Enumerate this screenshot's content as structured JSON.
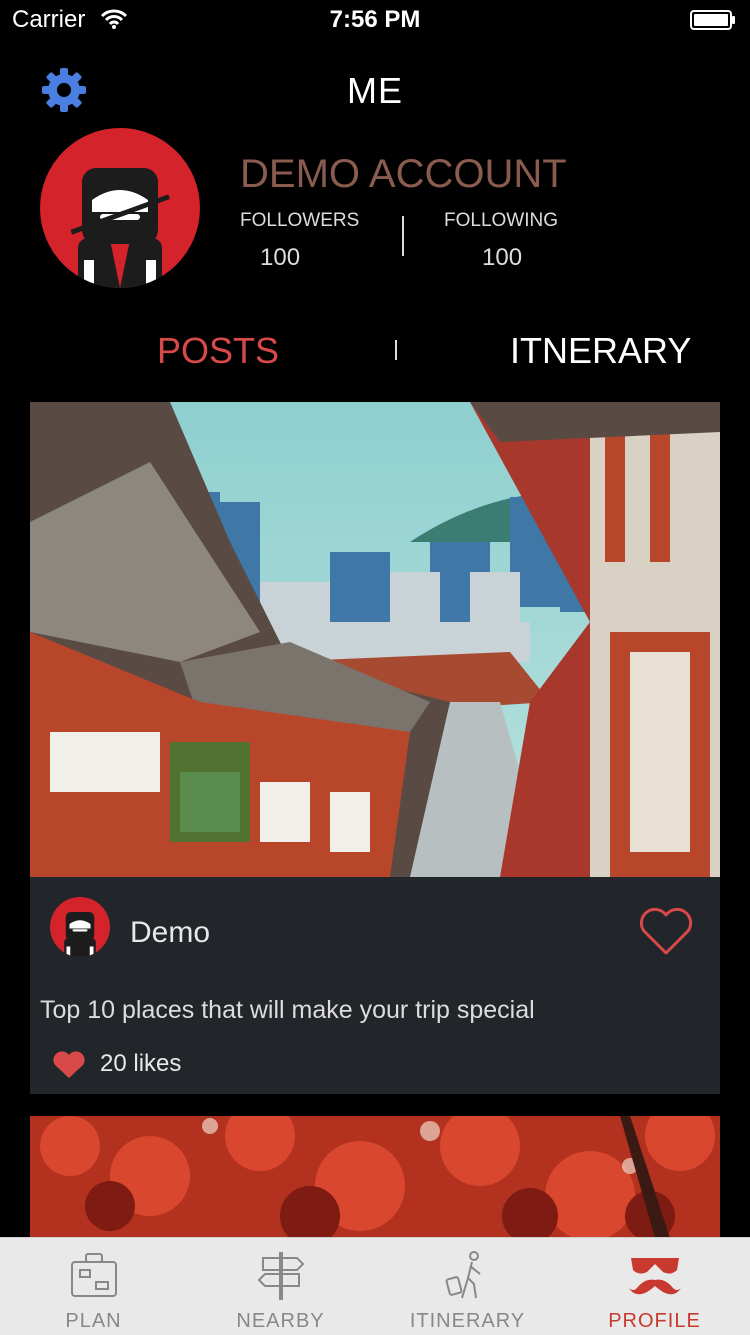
{
  "status_bar": {
    "carrier": "Carrier",
    "time": "7:56 PM"
  },
  "header": {
    "title": "ME"
  },
  "profile": {
    "name": "DEMO ACCOUNT",
    "followers_label": "FOLLOWERS",
    "followers_count": "100",
    "following_label": "FOLLOWING",
    "following_count": "100"
  },
  "tabs": {
    "posts": "POSTS",
    "itinerary": "ITNERARY",
    "active": "posts"
  },
  "posts": [
    {
      "author": "Demo",
      "caption": "Top 10 places that will make your trip special",
      "likes": "20 likes",
      "image": "traditional-houses-street-photo"
    },
    {
      "image": "red-maple-trees-photo"
    }
  ],
  "tabbar": {
    "items": [
      {
        "label": "PLAN",
        "icon": "luggage-icon"
      },
      {
        "label": "NEARBY",
        "icon": "signpost-icon"
      },
      {
        "label": "ITINERARY",
        "icon": "traveler-icon"
      },
      {
        "label": "PROFILE",
        "icon": "mustache-glasses-icon"
      }
    ],
    "active": "PROFILE"
  },
  "colors": {
    "accent": "#d84a4a",
    "account_name": "#8a5b4f",
    "card_bg": "#222529",
    "gear": "#4a7ee0",
    "tab_active": "#c8392f"
  }
}
